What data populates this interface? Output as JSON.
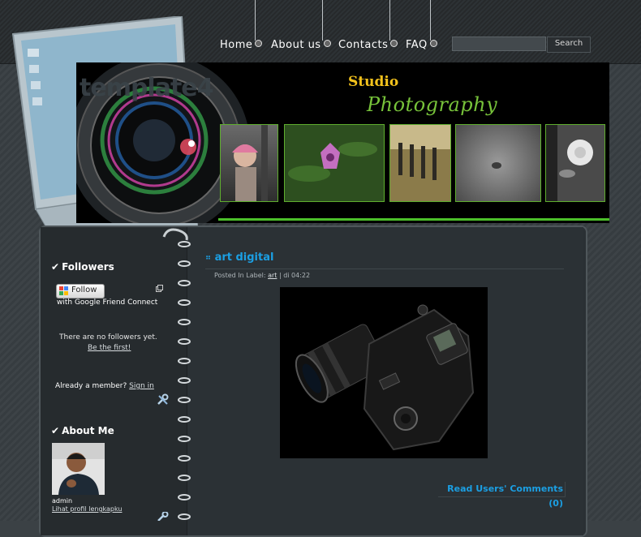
{
  "nav": {
    "items": [
      {
        "label": "Home"
      },
      {
        "label": "About us"
      },
      {
        "label": "Contacts"
      },
      {
        "label": "FAQ"
      }
    ]
  },
  "search": {
    "button_label": "Search",
    "value": ""
  },
  "header": {
    "blog_title": "template4",
    "studio": "Studio",
    "photography": "Photography"
  },
  "sidebar": {
    "followers": {
      "title": "Followers",
      "follow_button": "Follow",
      "gfc_text": "with Google Friend Connect",
      "no_followers": "There are no followers yet.",
      "be_first": "Be the first!",
      "already_member": "Already a member?",
      "sign_in": "Sign in"
    },
    "about": {
      "title": "About Me",
      "name": "admin",
      "profile_link": "Lihat profil lengkapku"
    }
  },
  "post": {
    "title": "art digital",
    "meta_prefix": "Posted In Label:",
    "label": "art",
    "separator": "|",
    "time": "di 04:22",
    "comments_link": "Read Users' Comments (0)"
  }
}
